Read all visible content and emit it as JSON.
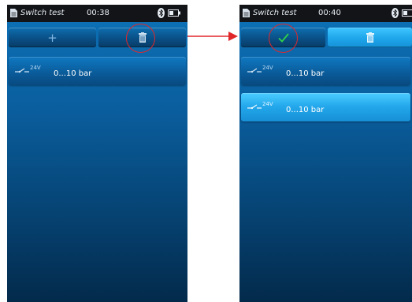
{
  "screens": [
    {
      "title": "Switch test",
      "time": "00:38",
      "toolbar": {
        "add_label": "+",
        "delete_icon": "trash-icon"
      },
      "rows": [
        {
          "voltage": "24V",
          "range": "0...10 bar",
          "selected": false
        }
      ],
      "highlight": "delete-button"
    },
    {
      "title": "Switch test",
      "time": "00:40",
      "toolbar": {
        "confirm_icon": "checkmark-icon",
        "delete_icon": "trash-icon",
        "delete_active": true
      },
      "rows": [
        {
          "voltage": "24V",
          "range": "0...10 bar",
          "selected": false
        },
        {
          "voltage": "24V",
          "range": "0...10 bar",
          "selected": true
        }
      ],
      "highlight": "confirm-button"
    }
  ],
  "colors": {
    "highlight_circle": "#e0282b",
    "arrow": "#e0282b",
    "checkmark": "#2fd24a",
    "status_bar": "#121417"
  }
}
